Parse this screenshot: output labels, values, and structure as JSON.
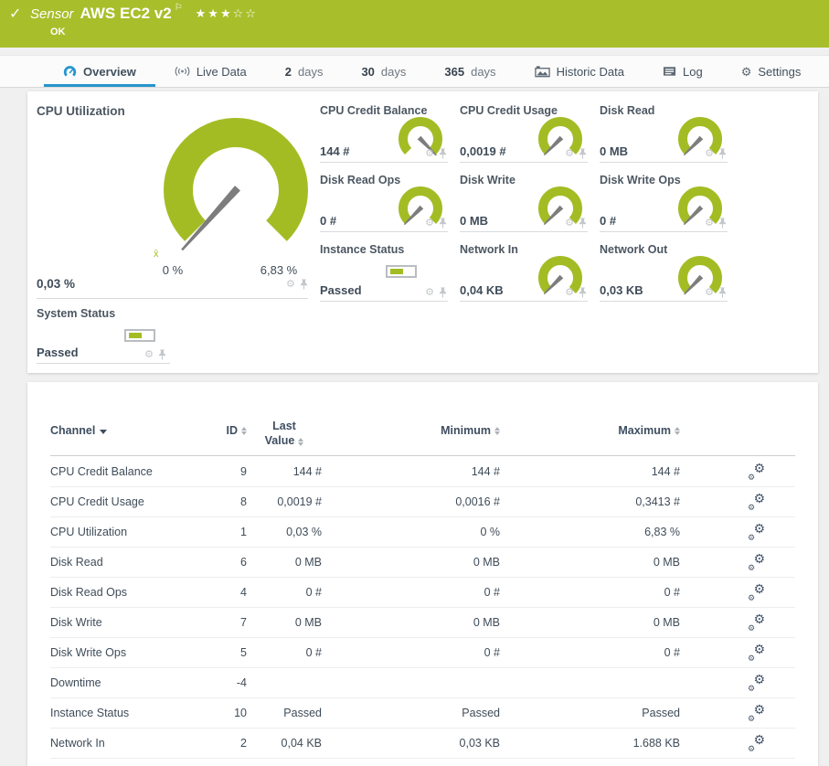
{
  "colors": {
    "brand_green": "#a8bf2b",
    "gauge_green": "#a4bc24",
    "accent_blue": "#2496cc",
    "needle_gray": "#7d7d7d"
  },
  "header": {
    "kind": "Sensor",
    "name": "AWS EC2 v2",
    "status": "OK",
    "stars": "★★★☆☆"
  },
  "tabs": {
    "overview": "Overview",
    "live_data": "Live Data",
    "days2_num": "2",
    "days2_unit": "days",
    "days30_num": "30",
    "days30_unit": "days",
    "days365_num": "365",
    "days365_unit": "days",
    "historic": "Historic Data",
    "log": "Log",
    "settings": "Settings"
  },
  "overview": {
    "main_gauge": {
      "title": "CPU Utilization",
      "value": "0,03 %",
      "min_label": "0 %",
      "max_label": "6,83 %",
      "mean_marker": "x̄",
      "needle_deg": 132
    },
    "channels": [
      {
        "title": "CPU Credit Balance",
        "value": "144 #",
        "display": "gauge",
        "needle_deg": 46
      },
      {
        "title": "CPU Credit Usage",
        "value": "0,0019 #",
        "display": "gauge",
        "needle_deg": 135
      },
      {
        "title": "Disk Read",
        "value": "0 MB",
        "display": "gauge",
        "needle_deg": 135
      },
      {
        "title": "Disk Read Ops",
        "value": "0 #",
        "display": "gauge",
        "needle_deg": 135
      },
      {
        "title": "Disk Write",
        "value": "0 MB",
        "display": "gauge",
        "needle_deg": 135
      },
      {
        "title": "Disk Write Ops",
        "value": "0 #",
        "display": "gauge",
        "needle_deg": 135
      },
      {
        "title": "Instance Status",
        "value": "Passed",
        "display": "toggle"
      },
      {
        "title": "Network In",
        "value": "0,04 KB",
        "display": "gauge",
        "needle_deg": 135
      },
      {
        "title": "Network Out",
        "value": "0,03 KB",
        "display": "gauge",
        "needle_deg": 134
      }
    ],
    "system_status": {
      "title": "System Status",
      "value": "Passed",
      "display": "toggle"
    }
  },
  "table": {
    "columns": {
      "channel": "Channel",
      "id": "ID",
      "last_line1": "Last",
      "last_line2": "Value",
      "min": "Minimum",
      "max": "Maximum"
    },
    "rows": [
      {
        "channel": "CPU Credit Balance",
        "id": "9",
        "last": "144 #",
        "min": "144 #",
        "max": "144 #"
      },
      {
        "channel": "CPU Credit Usage",
        "id": "8",
        "last": "0,0019 #",
        "min": "0,0016 #",
        "max": "0,3413 #"
      },
      {
        "channel": "CPU Utilization",
        "id": "1",
        "last": "0,03 %",
        "min": "0 %",
        "max": "6,83 %"
      },
      {
        "channel": "Disk Read",
        "id": "6",
        "last": "0 MB",
        "min": "0 MB",
        "max": "0 MB"
      },
      {
        "channel": "Disk Read Ops",
        "id": "4",
        "last": "0 #",
        "min": "0 #",
        "max": "0 #"
      },
      {
        "channel": "Disk Write",
        "id": "7",
        "last": "0 MB",
        "min": "0 MB",
        "max": "0 MB"
      },
      {
        "channel": "Disk Write Ops",
        "id": "5",
        "last": "0 #",
        "min": "0 #",
        "max": "0 #"
      },
      {
        "channel": "Downtime",
        "id": "-4",
        "last": "",
        "min": "",
        "max": ""
      },
      {
        "channel": "Instance Status",
        "id": "10",
        "last": "Passed",
        "min": "Passed",
        "max": "Passed"
      },
      {
        "channel": "Network In",
        "id": "2",
        "last": "0,04 KB",
        "min": "0,03 KB",
        "max": "1.688 KB"
      }
    ]
  }
}
